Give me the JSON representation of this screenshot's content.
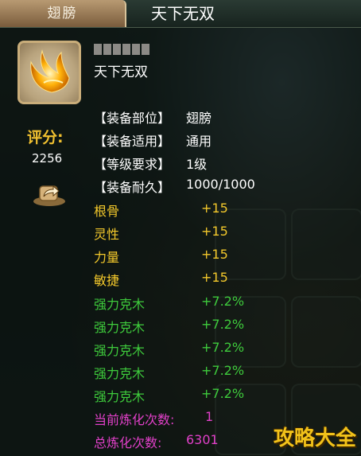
{
  "header": {
    "tab_label": "翅膀",
    "title": "天下无双"
  },
  "item": {
    "name": "天下无双",
    "quality_pips": 6,
    "icon": "wing-icon"
  },
  "score": {
    "label": "评分:",
    "value": "2256"
  },
  "share": {
    "icon": "share-icon"
  },
  "info_rows": [
    {
      "key": "【装备部位】",
      "value": "翅膀"
    },
    {
      "key": "【装备适用】",
      "value": "通用"
    },
    {
      "key": "【等级要求】",
      "value": "1级"
    },
    {
      "key": "【装备耐久】",
      "value": "1000/1000"
    }
  ],
  "base_stats": [
    {
      "name": "根骨",
      "value": "+15"
    },
    {
      "name": "灵性",
      "value": "+15"
    },
    {
      "name": "力量",
      "value": "+15"
    },
    {
      "name": "敏捷",
      "value": "+15"
    }
  ],
  "bonus_stats": [
    {
      "name": "强力克木",
      "value": "+7.2%"
    },
    {
      "name": "强力克木",
      "value": "+7.2%"
    },
    {
      "name": "强力克木",
      "value": "+7.2%"
    },
    {
      "name": "强力克木",
      "value": "+7.2%"
    },
    {
      "name": "强力克木",
      "value": "+7.2%"
    }
  ],
  "refine": {
    "current_label": "当前炼化次数:",
    "current_value": "1",
    "total_label": "总炼化次数:",
    "total_value": "6301"
  },
  "watermark": "攻略大全",
  "colors": {
    "gold": "#f3c82b",
    "green": "#3ecb3c",
    "pink": "#e040c8",
    "tab": "#b89a72"
  }
}
